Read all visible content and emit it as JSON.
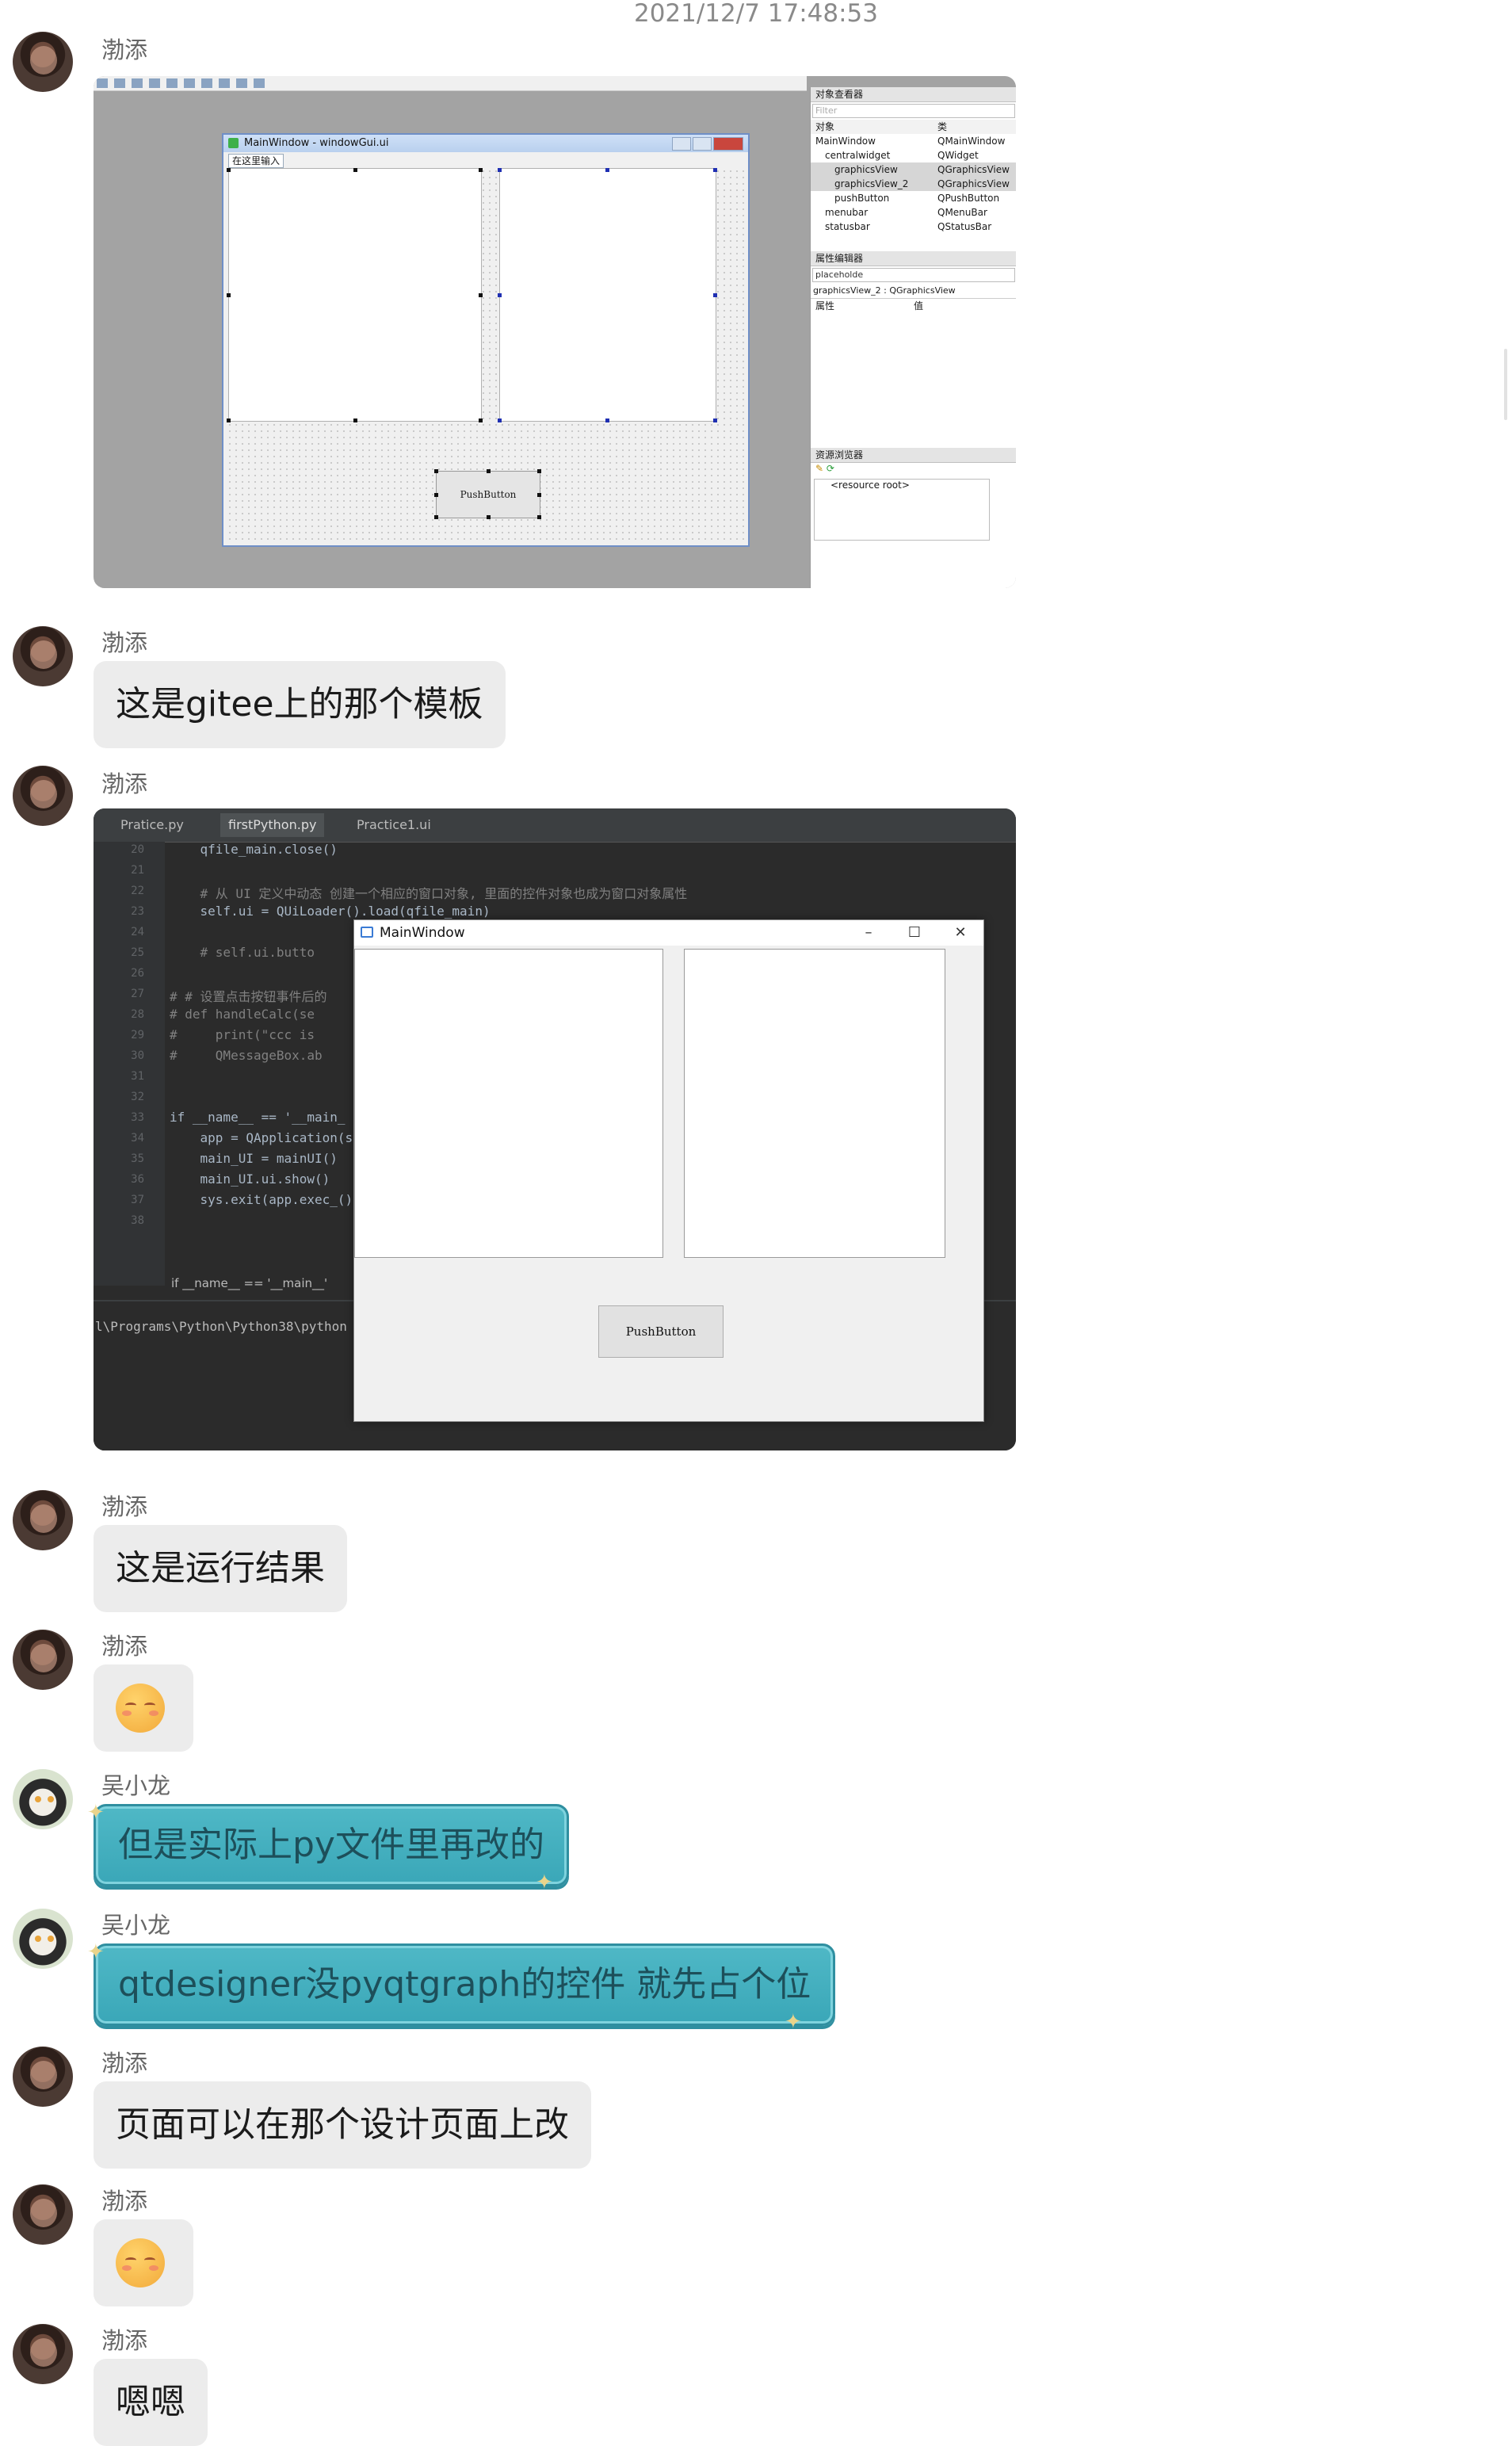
{
  "timestamp": "2021/12/7 17:48:53",
  "users": {
    "a": "渤添",
    "b": "吴小龙"
  },
  "messages": [
    {
      "sender": "渤添",
      "type": "image",
      "content": "qt-designer-screenshot"
    },
    {
      "sender": "渤添",
      "type": "text",
      "text": "这是gitee上的那个模板"
    },
    {
      "sender": "渤添",
      "type": "image",
      "content": "pycharm-run-screenshot"
    },
    {
      "sender": "渤添",
      "type": "text",
      "text": "这是运行结果"
    },
    {
      "sender": "渤添",
      "type": "emoji"
    },
    {
      "sender": "吴小龙",
      "type": "text",
      "text": "但是实际上py文件里再改的"
    },
    {
      "sender": "吴小龙",
      "type": "text",
      "text": "qtdesigner没pyqtgraph的控件 就先占个位"
    },
    {
      "sender": "渤添",
      "type": "text",
      "text": "页面可以在那个设计页面上改"
    },
    {
      "sender": "渤添",
      "type": "emoji"
    },
    {
      "sender": "渤添",
      "type": "text",
      "text": "嗯嗯"
    }
  ],
  "designer": {
    "form_title": "MainWindow - windowGui.ui",
    "menu_placeholder": "在这里输入",
    "push_button": "PushButton",
    "object_inspector": {
      "title": "对象查看器",
      "filter": "Filter",
      "headers": [
        "对象",
        "类"
      ],
      "rows": [
        {
          "name": "MainWindow",
          "cls": "QMainWindow",
          "indent": 0,
          "sel": false
        },
        {
          "name": "centralwidget",
          "cls": "QWidget",
          "indent": 1,
          "sel": false
        },
        {
          "name": "graphicsView",
          "cls": "QGraphicsView",
          "indent": 2,
          "sel": true
        },
        {
          "name": "graphicsView_2",
          "cls": "QGraphicsView",
          "indent": 2,
          "sel": true
        },
        {
          "name": "pushButton",
          "cls": "QPushButton",
          "indent": 2,
          "sel": false
        },
        {
          "name": "menubar",
          "cls": "QMenuBar",
          "indent": 1,
          "sel": false
        },
        {
          "name": "statusbar",
          "cls": "QStatusBar",
          "indent": 1,
          "sel": false
        }
      ]
    },
    "property_editor": {
      "title": "属性编辑器",
      "filter": "placeholde",
      "selected": "graphicsView_2 : QGraphicsView",
      "headers": [
        "属性",
        "值"
      ]
    },
    "resource_browser": {
      "title": "资源浏览器",
      "root": "<resource root>"
    }
  },
  "pycharm": {
    "tabs": [
      "Pratice.py",
      "firstPython.py",
      "Practice1.ui"
    ],
    "lines": [
      {
        "n": "20",
        "code": "    qfile_main.close()"
      },
      {
        "n": "21",
        "code": ""
      },
      {
        "n": "22",
        "code": "    # 从 UI 定义中动态 创建一个相应的窗口对象, 里面的控件对象也成为窗口对象属性"
      },
      {
        "n": "23",
        "code": "    self.ui = QUiLoader().load(qfile_main)"
      },
      {
        "n": "24",
        "code": ""
      },
      {
        "n": "25",
        "code": "    # self.ui.butto"
      },
      {
        "n": "26",
        "code": ""
      },
      {
        "n": "27",
        "code": "# # 设置点击按钮事件后的"
      },
      {
        "n": "28",
        "code": "# def handleCalc(se"
      },
      {
        "n": "29",
        "code": "#     print(\"ccc is"
      },
      {
        "n": "30",
        "code": "#     QMessageBox.ab"
      },
      {
        "n": "31",
        "code": ""
      },
      {
        "n": "32",
        "code": ""
      },
      {
        "n": "33",
        "code": "if __name__ == '__main_"
      },
      {
        "n": "34",
        "code": "    app = QApplication(s"
      },
      {
        "n": "35",
        "code": "    main_UI = mainUI()"
      },
      {
        "n": "36",
        "code": "    main_UI.ui.show()"
      },
      {
        "n": "37",
        "code": "    sys.exit(app.exec_()"
      },
      {
        "n": "38",
        "code": ""
      }
    ],
    "breadcrumb": "if __name__ == '__main__'",
    "terminal": "l\\Programs\\Python\\Python38\\python",
    "window_title": "MainWindow",
    "push_button": "PushButton",
    "window_controls": [
      "–",
      "☐",
      "✕"
    ]
  }
}
